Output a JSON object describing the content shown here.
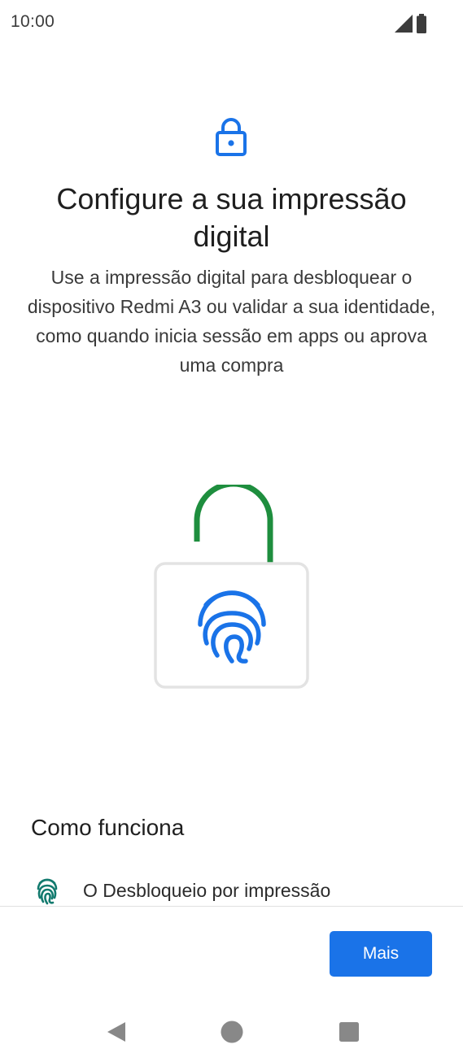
{
  "status_bar": {
    "time": "10:00",
    "icons": [
      "signal-icon",
      "battery-icon"
    ]
  },
  "header": {
    "icon": "lock-icon",
    "title": "Configure a sua impressão digital",
    "description": "Use a impressão digital para desbloquear o dispositivo Redmi A3 ou validar a sua identidade, como quando inicia sessão em apps ou aprova uma compra"
  },
  "illustration": {
    "icon": "fingerprint-unlock-illustration",
    "shackle_color": "#1e8e3e",
    "fingerprint_color": "#1a73e8",
    "body_border_color": "#e3e3e3"
  },
  "how_it_works": {
    "heading": "Como funciona",
    "items": [
      {
        "icon": "fingerprint-icon",
        "text": "O Desbloqueio por impressão"
      }
    ]
  },
  "footer": {
    "more_label": "Mais",
    "accent_color": "#1a73e8"
  },
  "nav": {
    "back": "back-icon",
    "home": "home-icon",
    "recents": "recents-icon"
  }
}
